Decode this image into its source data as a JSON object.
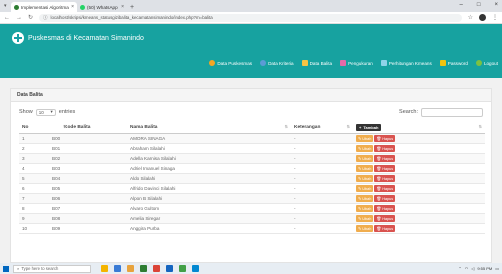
{
  "browser": {
    "tabs": [
      {
        "title": "Implementasi Algoritma K-mea...",
        "close": "×"
      },
      {
        "title": "(50) WhatsApp",
        "close": "×"
      }
    ],
    "new_tab": "+",
    "window_controls": [
      "–",
      "□",
      "×"
    ],
    "url": "localhost/skripsi/kmeans_statusgizibalita_kecamatansimanindo/index.php?m=balita"
  },
  "app": {
    "title": "Puskesmas di Kecamatan Simanindo",
    "nav": [
      {
        "label": "Data Puskesmas",
        "icon": "building-icon",
        "color": "orange"
      },
      {
        "label": "Data Kriteria",
        "icon": "criteria-icon",
        "color": "blue"
      },
      {
        "label": "Data Balita",
        "icon": "folder-icon",
        "color": "yellow"
      },
      {
        "label": "Pengukuran",
        "icon": "chart-icon",
        "color": "pink"
      },
      {
        "label": "Perhitungan Kmeans",
        "icon": "calculator-icon",
        "color": "teal"
      },
      {
        "label": "Password",
        "icon": "key-icon",
        "color": "gold"
      },
      {
        "label": "Logout",
        "icon": "logout-icon",
        "color": "green"
      }
    ]
  },
  "panel": {
    "title": "Data Balita",
    "show_label": "Show",
    "entries_value": "10",
    "entries_label": "entries",
    "search_label": "Search:",
    "search_value": ""
  },
  "table": {
    "headers": [
      "No",
      "Kode Balita",
      "Nama Balita",
      "Keterangan"
    ],
    "add_button": "Tambah",
    "edit_label": "Ubah",
    "delete_label": "Hapus",
    "rows": [
      {
        "no": "1",
        "kode": "B00",
        "nama": "AMORA SINAGA",
        "ket": "-"
      },
      {
        "no": "2",
        "kode": "B01",
        "nama": "Abraham Silalahi",
        "ket": "-"
      },
      {
        "no": "3",
        "kode": "B02",
        "nama": "Adella Karnisa Silalahi",
        "ket": "-"
      },
      {
        "no": "4",
        "kode": "B03",
        "nama": "Adriel Imanuel Sinaga",
        "ket": "-"
      },
      {
        "no": "5",
        "kode": "B04",
        "nama": "Aldo Silalahi",
        "ket": "-"
      },
      {
        "no": "6",
        "kode": "B05",
        "nama": "Alfrido Davinci Silalahi",
        "ket": "-"
      },
      {
        "no": "7",
        "kode": "B06",
        "nama": "Alpon B Silalahi",
        "ket": "-"
      },
      {
        "no": "8",
        "kode": "B07",
        "nama": "Alvaro Gultom",
        "ket": "-"
      },
      {
        "no": "9",
        "kode": "B08",
        "nama": "Amelia Siregar",
        "ket": "-"
      },
      {
        "no": "10",
        "kode": "B09",
        "nama": "Anggira Purba",
        "ket": "-"
      }
    ]
  },
  "taskbar": {
    "search_placeholder": "Type here to search",
    "time": "9:55 PM"
  }
}
